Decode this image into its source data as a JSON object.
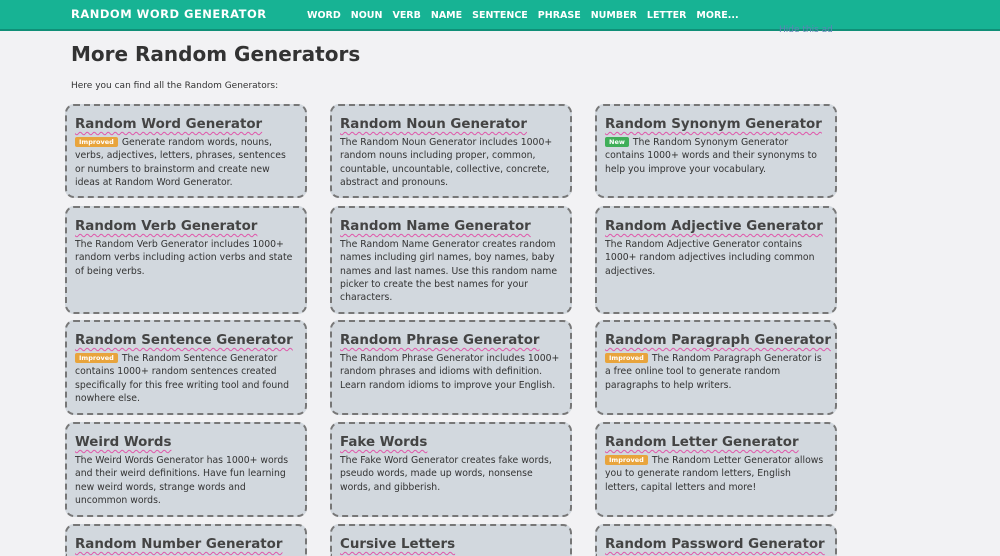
{
  "header": {
    "brand": "RANDOM WORD GENERATOR",
    "nav": [
      "WORD",
      "NOUN",
      "VERB",
      "NAME",
      "SENTENCE",
      "PHRASE",
      "NUMBER",
      "LETTER",
      "MORE..."
    ]
  },
  "ad": {
    "hide_label": "Hide this ad"
  },
  "main": {
    "title": "More Random Generators",
    "intro": "Here you can find all the Random Generators:"
  },
  "colors": {
    "header": "#17b394",
    "card": "#d2d8de",
    "improved_badge": "#e8a43c",
    "new_badge": "#3fae58"
  },
  "cards": [
    {
      "title": "Random Word Generator",
      "badge": "Improved",
      "desc": "Generate random words, nouns, verbs, adjectives, letters, phrases, sentences or numbers to brainstorm and create new ideas at Random Word Generator."
    },
    {
      "title": "Random Noun Generator",
      "badge": "",
      "desc": "The Random Noun Generator includes 1000+ random nouns including proper, common, countable, uncountable, collective, concrete, abstract and pronouns."
    },
    {
      "title": "Random Synonym Generator",
      "badge": "New",
      "desc": "The Random Synonym Generator contains 1000+ words and their synonyms to help you improve your vocabulary."
    },
    {
      "title": "Random Verb Generator",
      "badge": "",
      "desc": "The Random Verb Generator includes 1000+ random verbs including action verbs and state of being verbs."
    },
    {
      "title": "Random Name Generator",
      "badge": "",
      "desc": "The Random Name Generator creates random names including girl names, boy names, baby names and last names. Use this random name picker to create the best names for your characters."
    },
    {
      "title": "Random Adjective Generator",
      "badge": "",
      "desc": "The Random Adjective Generator contains 1000+ random adjectives including common adjectives."
    },
    {
      "title": "Random Sentence Generator",
      "badge": "Improved",
      "desc": "The Random Sentence Generator contains 1000+ random sentences created specifically for this free writing tool and found nowhere else."
    },
    {
      "title": "Random Phrase Generator",
      "badge": "",
      "desc": "The Random Phrase Generator includes 1000+ random phrases and idioms with definition. Learn random idioms to improve your English."
    },
    {
      "title": "Random Paragraph Generator",
      "badge": "Improved",
      "desc": "The Random Paragraph Generator is a free online tool to generate random paragraphs to help writers."
    },
    {
      "title": "Weird Words",
      "badge": "",
      "desc": "The Weird Words Generator has 1000+ words and their weird definitions. Have fun learning new weird words, strange words and uncommon words."
    },
    {
      "title": "Fake Words",
      "badge": "",
      "desc": "The Fake Word Generator creates fake words, pseudo words, made up words, nonsense words, and gibberish."
    },
    {
      "title": "Random Letter Generator",
      "badge": "Improved",
      "desc": "The Random Letter Generator allows you to generate random letters, English letters, capital letters and more!"
    },
    {
      "title": "Random Number Generator",
      "badge": "",
      "desc": ""
    },
    {
      "title": "Cursive Letters",
      "badge": "",
      "desc": ""
    },
    {
      "title": "Random Password Generator",
      "badge": "",
      "desc": ""
    }
  ]
}
